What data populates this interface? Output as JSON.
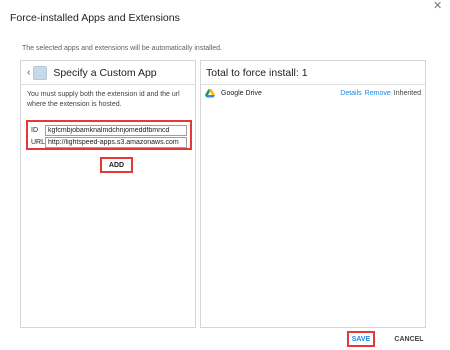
{
  "dialog": {
    "title": "Force-installed Apps and Extensions",
    "subtitle": "The selected apps and extensions will be automatically installed.",
    "close_icon": "close-icon"
  },
  "left_panel": {
    "back_icon": "chevron-left-icon",
    "app_icon": "app-tile-icon",
    "title": "Specify a Custom App",
    "help_text": "You must supply both the extension id and the url where the extension is hosted.",
    "id_label": "ID",
    "id_value": "kgfcmbjobamknalmdchnjomeddfbmncd",
    "url_label": "URL",
    "url_value": "http://lightspeed-apps.s3.amazonaws.com",
    "add_label": "ADD"
  },
  "right_panel": {
    "title": "Total to force install: 1",
    "apps": [
      {
        "icon": "google-drive-icon",
        "name": "Google Drive",
        "details_label": "Details",
        "remove_label": "Remove",
        "status": "Inherited"
      }
    ]
  },
  "footer": {
    "save_label": "SAVE",
    "cancel_label": "CANCEL"
  },
  "colors": {
    "highlight": "#e53935",
    "link": "#1e88e5",
    "border": "#d6d6d6"
  }
}
